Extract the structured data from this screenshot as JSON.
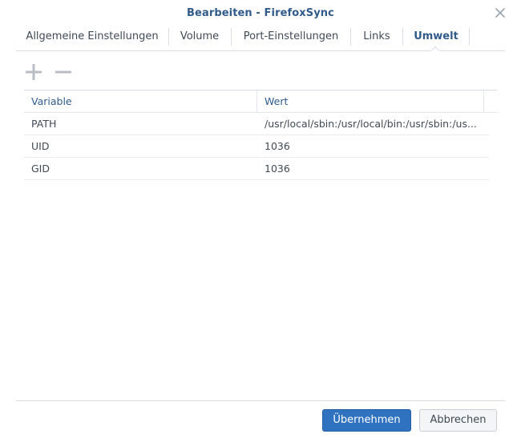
{
  "dialog": {
    "title": "Bearbeiten - FirefoxSync",
    "close_icon": "close-icon"
  },
  "tabs": [
    {
      "label": "Allgemeine Einstellungen",
      "active": false
    },
    {
      "label": "Volume",
      "active": false
    },
    {
      "label": "Port-Einstellungen",
      "active": false
    },
    {
      "label": "Links",
      "active": false
    },
    {
      "label": "Umwelt",
      "active": true
    }
  ],
  "toolbar": {
    "add_icon": "plus-icon",
    "remove_icon": "minus-icon"
  },
  "table": {
    "columns": [
      "Variable",
      "Wert"
    ],
    "rows": [
      [
        "PATH",
        "/usr/local/sbin:/usr/local/bin:/usr/sbin:/us..."
      ],
      [
        "UID",
        "1036"
      ],
      [
        "GID",
        "1036"
      ]
    ]
  },
  "footer": {
    "apply_label": "Übernehmen",
    "cancel_label": "Abbrechen"
  },
  "colors": {
    "accent": "#2f5a8a",
    "primary_button": "#2f72c0",
    "text": "#404a54",
    "border": "#d9dde3"
  }
}
